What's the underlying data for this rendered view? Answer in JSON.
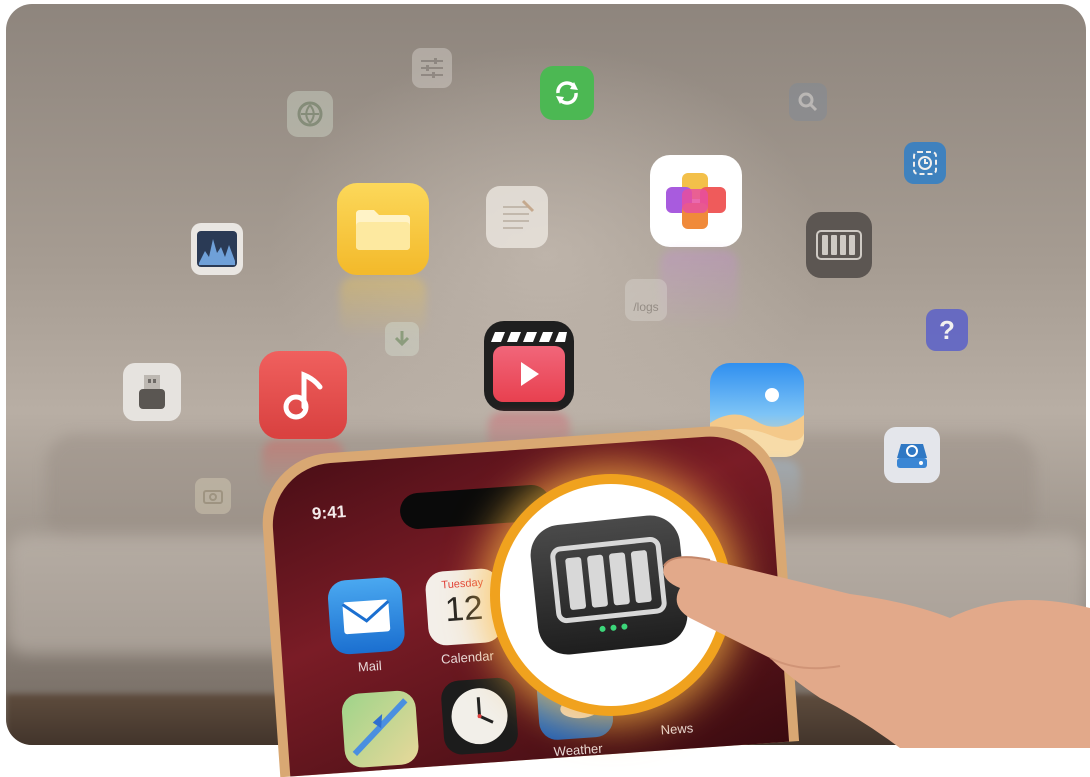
{
  "phone": {
    "status_time": "9:41",
    "apps": [
      {
        "label": "Mail",
        "icon": "mail-icon"
      },
      {
        "label": "Calendar",
        "icon": "calendar-icon",
        "weekday": "Tuesday",
        "day": "12"
      },
      {
        "label": "Weather",
        "icon": "weather-icon"
      },
      {
        "label": "News",
        "icon": "news-icon"
      },
      {
        "label": "",
        "icon": "maps-icon"
      },
      {
        "label": "",
        "icon": "clock-icon"
      }
    ]
  },
  "floating_icons": {
    "logs_label": "/logs",
    "help_glyph": "?",
    "items": [
      "files-icon",
      "notes-icon",
      "palette-app-icon",
      "nas-app-icon",
      "music-icon",
      "video-player-icon",
      "photos-icon",
      "storage-drive-icon",
      "usb-icon",
      "activity-monitor-icon",
      "sync-icon",
      "settings-sliders-icon",
      "vpn-icon",
      "search-icon",
      "timer-icon",
      "download-icon",
      "logs-icon",
      "help-icon",
      "camera-icon"
    ]
  },
  "colors": {
    "highlight_ring": "#f0a21e",
    "sync_green": "#4cb853",
    "music_red": "#e8504f",
    "files_yellow": "#f7c63a",
    "help_purple": "#5b61c9",
    "timer_blue": "#2f7fc8"
  }
}
